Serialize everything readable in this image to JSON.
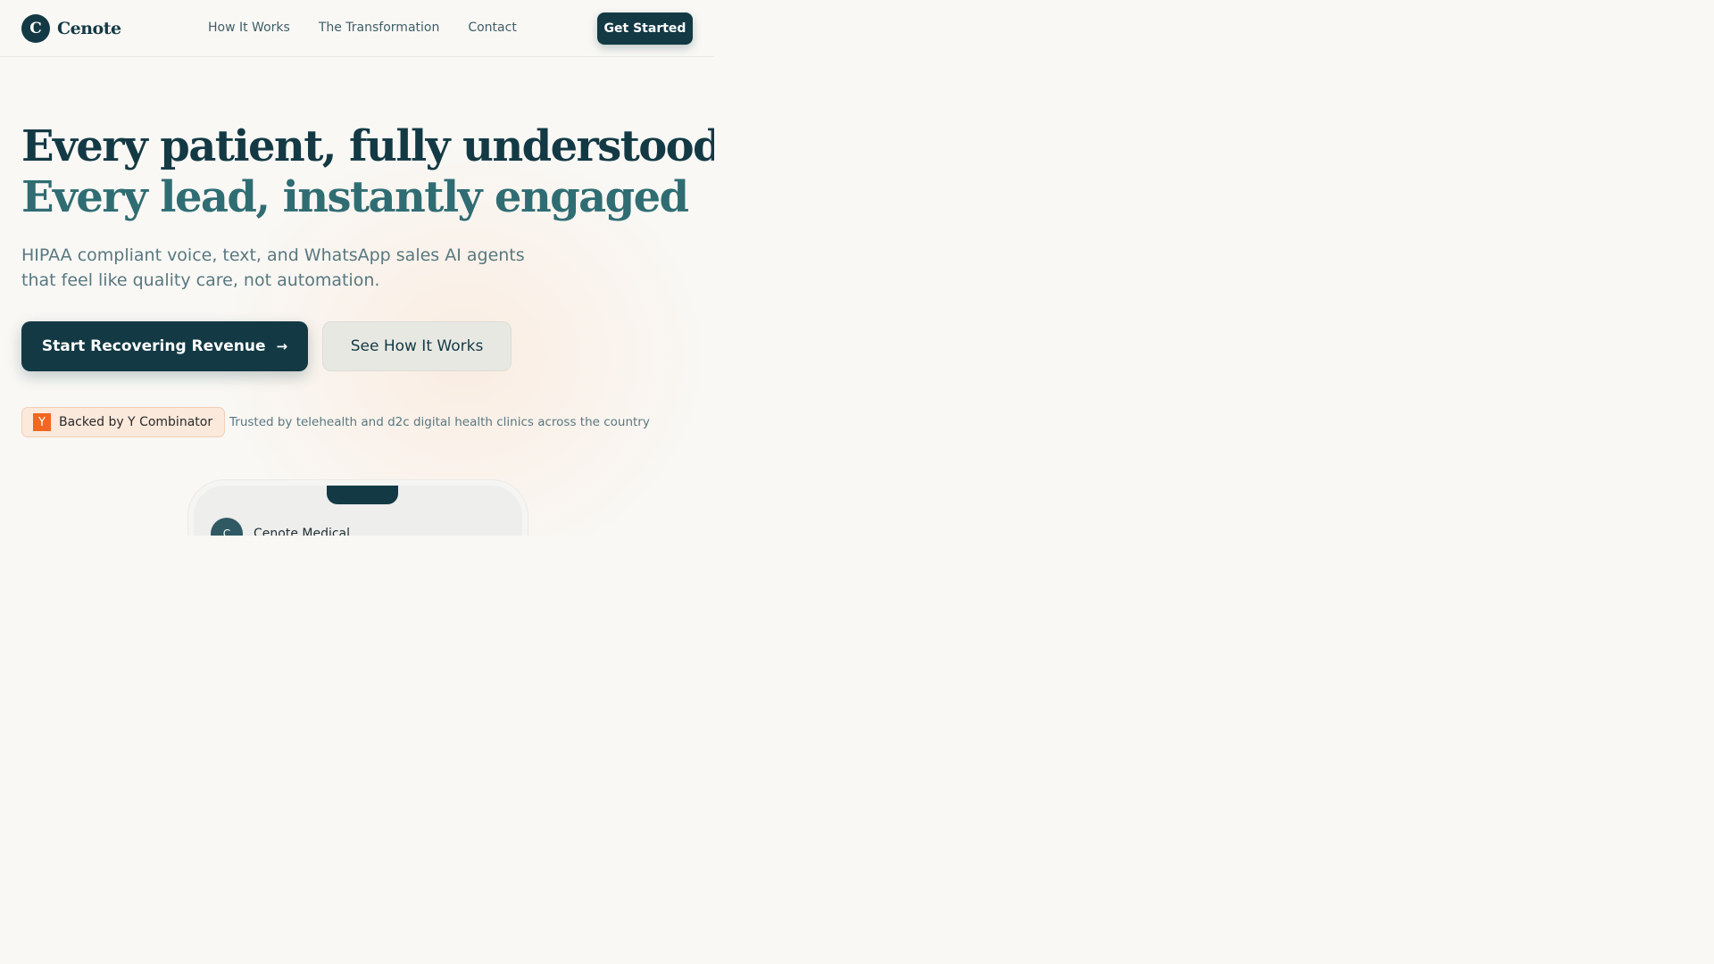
{
  "brand": {
    "logo_letter": "C",
    "name": "Cenote"
  },
  "nav": {
    "links": [
      "How It Works",
      "The Transformation",
      "Contact"
    ],
    "cta_label": "Get Started"
  },
  "hero": {
    "headline_line1": "Every patient, fully understood",
    "headline_line2": "Every lead, instantly engaged",
    "subhead_line1": "HIPAA compliant voice, text, and WhatsApp sales AI agents",
    "subhead_line2": "that feel like quality care, not automation.",
    "primary_cta": "Start Recovering Revenue",
    "primary_cta_icon": "→",
    "secondary_cta": "See How It Works"
  },
  "social_proof": {
    "yc_logo_letter": "Y",
    "yc_badge": "Backed by Y Combinator",
    "trust_text": "Trusted by telehealth and d2c digital health clinics across the country"
  },
  "phone_preview": {
    "avatar_letter": "C",
    "contact_name": "Cenote Medical"
  },
  "colors": {
    "brand_dark": "#133a44",
    "brand_teal": "#2f6d73",
    "text_muted": "#587880",
    "background": "#f9f8f5",
    "yc_orange": "#f26522",
    "yc_badge_bg": "#fbe9dc"
  }
}
